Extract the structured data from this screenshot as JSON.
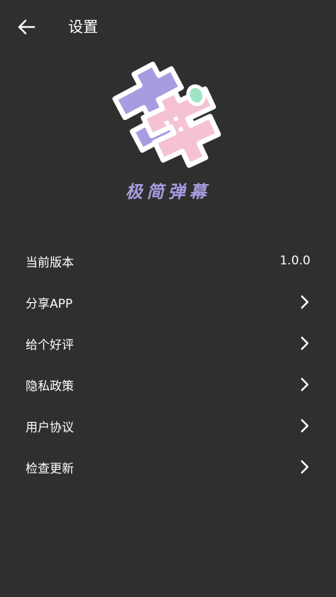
{
  "header": {
    "title": "设置"
  },
  "brand": {
    "name": "极简弹幕"
  },
  "settings": {
    "items": [
      {
        "label": "当前版本",
        "value": "1.0.0"
      },
      {
        "label": "分享APP"
      },
      {
        "label": "给个好评"
      },
      {
        "label": "隐私政策"
      },
      {
        "label": "用户协议"
      },
      {
        "label": "检查更新"
      }
    ]
  },
  "colors": {
    "background": "#2f2f2f",
    "logo_purple": "#a99be0",
    "logo_pink": "#f5c2d3",
    "logo_green": "#9fe3c5",
    "text": "#ffffff"
  },
  "icons": {
    "back": "arrow-left-icon",
    "chevron": "chevron-right-icon"
  }
}
